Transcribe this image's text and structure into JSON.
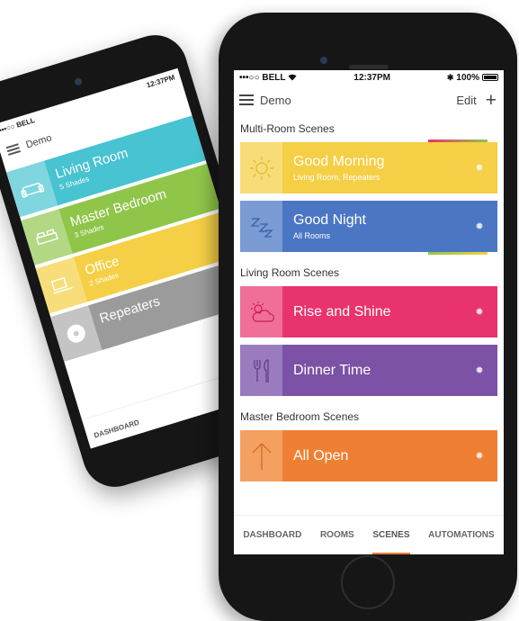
{
  "colors": {
    "yellow": "#f5cf45",
    "blue": "#4b76c3",
    "pink": "#e8336d",
    "purple": "#7b52a5",
    "orange": "#ef8033",
    "teal": "#47c3d1",
    "green": "#8fc64a",
    "gray": "#9b9b9b"
  },
  "back_phone": {
    "status": {
      "carrier": "•••○○ BELL",
      "time": "12:37PM"
    },
    "nav_title": "Demo",
    "rooms": [
      {
        "name": "Living Room",
        "sub": "5 Shades",
        "icon": "sofa-icon"
      },
      {
        "name": "Master Bedroom",
        "sub": "3 Shades",
        "icon": "bed-icon"
      },
      {
        "name": "Office",
        "sub": "2 Shades",
        "icon": "desk-icon"
      },
      {
        "name": "Repeaters",
        "sub": "",
        "icon": "repeater-icon"
      }
    ],
    "tab_dashboard": "DASHBOARD"
  },
  "front_phone": {
    "status": {
      "carrier": "•••○○ BELL",
      "time": "12:37PM",
      "battery": "100%"
    },
    "nav": {
      "title": "Demo",
      "edit": "Edit",
      "add": "+"
    },
    "sections": {
      "multi_room": "Multi-Room Scenes",
      "living_room": "Living Room Scenes",
      "master_bedroom": "Master Bedroom Scenes"
    },
    "scenes": {
      "good_morning": {
        "name": "Good Morning",
        "sub": "Living Room, Repeaters",
        "icon": "sun-icon"
      },
      "good_night": {
        "name": "Good Night",
        "sub": "All Rooms",
        "icon": "zzz-icon"
      },
      "rise_and_shine": {
        "name": "Rise and Shine",
        "icon": "cloud-sun-icon"
      },
      "dinner_time": {
        "name": "Dinner Time",
        "icon": "fork-knife-icon"
      },
      "all_open": {
        "name": "All Open",
        "icon": "arrow-up-icon"
      }
    },
    "tabs": [
      {
        "label": "DASHBOARD",
        "active": false
      },
      {
        "label": "ROOMS",
        "active": false
      },
      {
        "label": "SCENES",
        "active": true
      },
      {
        "label": "AUTOMATIONS",
        "active": false
      }
    ]
  }
}
